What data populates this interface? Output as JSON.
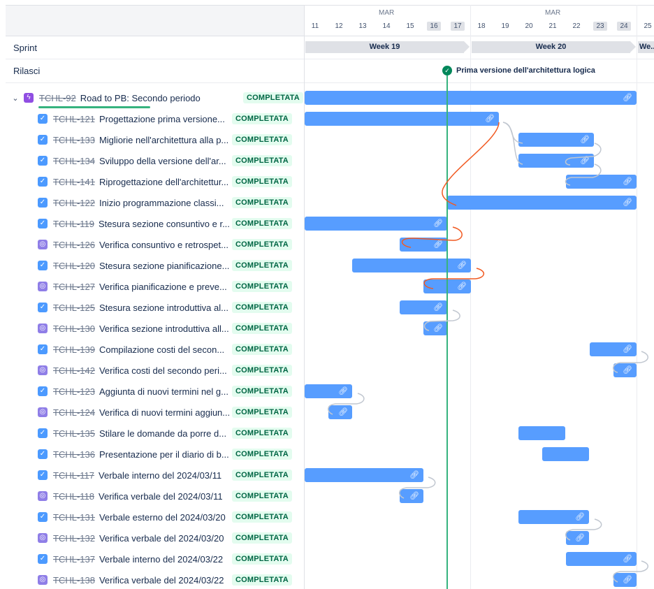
{
  "header": {
    "months": [
      "MAR",
      "MAR"
    ],
    "days": [
      "11",
      "12",
      "13",
      "14",
      "15",
      "16",
      "17",
      "18",
      "19",
      "20",
      "21",
      "22",
      "23",
      "24",
      "25"
    ]
  },
  "rows": {
    "sprint_label": "Sprint",
    "release_label": "Rilasci"
  },
  "sprints": [
    "Week 19",
    "Week 20",
    "We..."
  ],
  "release": {
    "label": "Prima versione dell'architettura logica"
  },
  "epic": {
    "key": "TCHL-92",
    "summary": "Road to PB: Secondo periodo",
    "status": "COMPLETATA"
  },
  "issues": [
    {
      "key": "TCHL-121",
      "summary": "Progettazione prima versione...",
      "status": "COMPLETATA",
      "type": "task"
    },
    {
      "key": "TCHL-133",
      "summary": "Migliorie nell'architettura alla p...",
      "status": "COMPLETATA",
      "type": "task"
    },
    {
      "key": "TCHL-134",
      "summary": "Sviluppo della versione dell'ar...",
      "status": "COMPLETATA",
      "type": "task"
    },
    {
      "key": "TCHL-141",
      "summary": "Riprogettazione dell'architettur...",
      "status": "COMPLETATA",
      "type": "task"
    },
    {
      "key": "TCHL-122",
      "summary": "Inizio programmazione classi...",
      "status": "COMPLETATA",
      "type": "task"
    },
    {
      "key": "TCHL-119",
      "summary": "Stesura sezione consuntivo e r...",
      "status": "COMPLETATA",
      "type": "task"
    },
    {
      "key": "TCHL-126",
      "summary": "Verifica consuntivo e retrospet...",
      "status": "COMPLETATA",
      "type": "subtask"
    },
    {
      "key": "TCHL-120",
      "summary": "Stesura sezione pianificazione...",
      "status": "COMPLETATA",
      "type": "task"
    },
    {
      "key": "TCHL-127",
      "summary": "Verifica pianificazione e preve...",
      "status": "COMPLETATA",
      "type": "subtask"
    },
    {
      "key": "TCHL-125",
      "summary": "Stesura sezione introduttiva al...",
      "status": "COMPLETATA",
      "type": "task"
    },
    {
      "key": "TCHL-130",
      "summary": "Verifica sezione introduttiva all...",
      "status": "COMPLETATA",
      "type": "subtask"
    },
    {
      "key": "TCHL-139",
      "summary": "Compilazione costi del secon...",
      "status": "COMPLETATA",
      "type": "task"
    },
    {
      "key": "TCHL-142",
      "summary": "Verifica costi del secondo peri...",
      "status": "COMPLETATA",
      "type": "subtask"
    },
    {
      "key": "TCHL-123",
      "summary": "Aggiunta di nuovi termini nel g...",
      "status": "COMPLETATA",
      "type": "task"
    },
    {
      "key": "TCHL-124",
      "summary": "Verifica di nuovi termini aggiun...",
      "status": "COMPLETATA",
      "type": "subtask"
    },
    {
      "key": "TCHL-135",
      "summary": "Stilare le domande da porre d...",
      "status": "COMPLETATA",
      "type": "task"
    },
    {
      "key": "TCHL-136",
      "summary": "Presentazione per il diario di b...",
      "status": "COMPLETATA",
      "type": "task"
    },
    {
      "key": "TCHL-117",
      "summary": "Verbale interno del 2024/03/11",
      "status": "COMPLETATA",
      "type": "task"
    },
    {
      "key": "TCHL-118",
      "summary": "Verifica verbale del 2024/03/11",
      "status": "COMPLETATA",
      "type": "subtask"
    },
    {
      "key": "TCHL-131",
      "summary": "Verbale esterno del 2024/03/20",
      "status": "COMPLETATA",
      "type": "task"
    },
    {
      "key": "TCHL-132",
      "summary": "Verifica verbale del 2024/03/20",
      "status": "COMPLETATA",
      "type": "subtask"
    },
    {
      "key": "TCHL-137",
      "summary": "Verbale interno del 2024/03/22",
      "status": "COMPLETATA",
      "type": "task"
    },
    {
      "key": "TCHL-138",
      "summary": "Verifica verbale del 2024/03/22",
      "status": "COMPLETATA",
      "type": "subtask"
    }
  ],
  "colors": {
    "bar": "#579dff",
    "today_line": "#36b37e",
    "dependency": "#c1c7d0",
    "dependency_conflict": "#f15a22",
    "status_bg": "#e3fcef",
    "status_text": "#006644"
  }
}
